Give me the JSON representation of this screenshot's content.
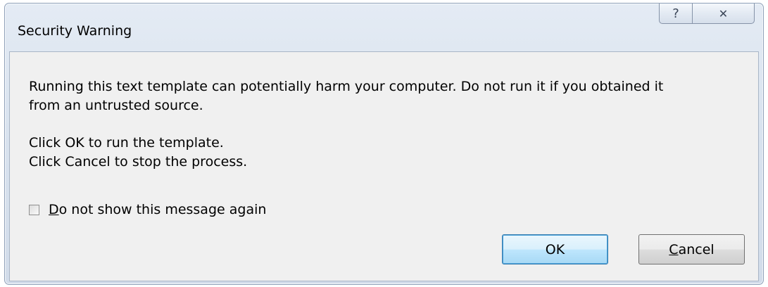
{
  "dialog": {
    "title": "Security Warning",
    "help_glyph": "?",
    "close_glyph": "✕"
  },
  "message": {
    "line1": "Running this text template can potentially harm your computer. Do not run it if you obtained it",
    "line2": "from an untrusted source.",
    "line3": "Click OK to run the template.",
    "line4": "Click Cancel to stop the process."
  },
  "checkbox": {
    "mnemonic": "D",
    "label_rest": "o not show this message again",
    "checked": false
  },
  "buttons": {
    "ok_label": "OK",
    "cancel_mnemonic": "C",
    "cancel_rest": "ancel"
  },
  "colors": {
    "client_bg": "#f0f0f0",
    "frame": "#d9e3ef",
    "default_button_border": "#3c7fb1"
  }
}
